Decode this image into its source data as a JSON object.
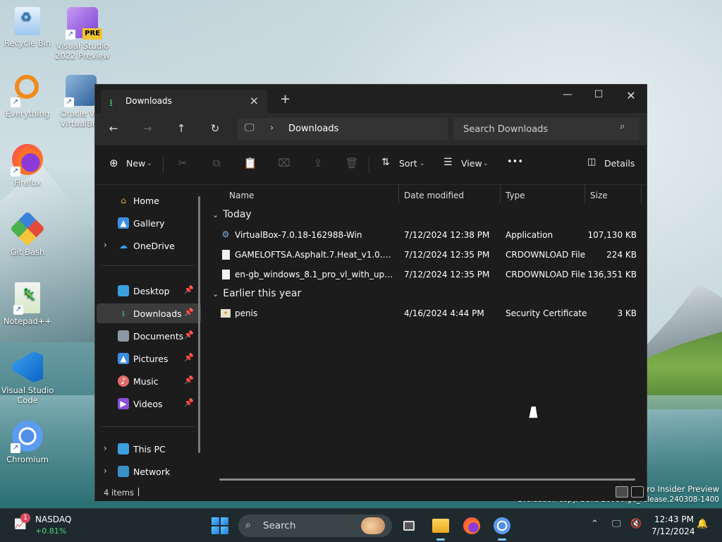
{
  "desktop": {
    "icons": [
      {
        "label": "Recycle Bin"
      },
      {
        "label": "Visual Studio 2022 Preview",
        "badge": "PRE"
      },
      {
        "label": "Everything"
      },
      {
        "label": "Oracle VM VirtualBox"
      },
      {
        "label": "Firefox"
      },
      {
        "label": "Git Bash"
      },
      {
        "label": "Notepad++"
      },
      {
        "label": "Visual Studio Code"
      },
      {
        "label": "Chromium"
      }
    ],
    "watermark_line1": "Pro Insider Preview",
    "watermark_line2": "Evaluation copy. Build 26080.ge_release.240308-1400"
  },
  "window": {
    "tab_title": "Downloads",
    "address_crumb": "Downloads",
    "search_placeholder": "Search Downloads",
    "toolbar": {
      "new_label": "New",
      "sort_label": "Sort",
      "view_label": "View",
      "more_label": "•••",
      "details_label": "Details"
    },
    "sidebar": {
      "items": [
        {
          "label": "Home"
        },
        {
          "label": "Gallery"
        },
        {
          "label": "OneDrive"
        },
        {
          "label": "Desktop"
        },
        {
          "label": "Downloads"
        },
        {
          "label": "Documents"
        },
        {
          "label": "Pictures"
        },
        {
          "label": "Music"
        },
        {
          "label": "Videos"
        },
        {
          "label": "This PC"
        },
        {
          "label": "Network"
        }
      ]
    },
    "columns": {
      "name": "Name",
      "date": "Date modified",
      "type": "Type",
      "size": "Size"
    },
    "groups": [
      {
        "label": "Today",
        "files": [
          {
            "name": "VirtualBox-7.0.18-162988-Win",
            "date": "7/12/2024 12:38 PM",
            "type": "Application",
            "size": "107,130 KB"
          },
          {
            "name": "GAMELOFTSA.Asphalt.7.Heat_v1.0.2.2.zip.crdownload",
            "date": "7/12/2024 12:35 PM",
            "type": "CRDOWNLOAD File",
            "size": "224 KB"
          },
          {
            "name": "en-gb_windows_8.1_pro_vl_with_update_x64.iso.crdownload",
            "date": "7/12/2024 12:35 PM",
            "type": "CRDOWNLOAD File",
            "size": "136,351 KB"
          }
        ]
      },
      {
        "label": "Earlier this year",
        "files": [
          {
            "name": "penis",
            "date": "4/16/2024 4:44 PM",
            "type": "Security Certificate",
            "size": "3 KB"
          }
        ]
      }
    ],
    "status_count": "4 items"
  },
  "taskbar": {
    "widget_badge": "1",
    "widget_title": "NASDAQ",
    "widget_value": "+0.81%",
    "search_label": "Search",
    "clock_time": "12:43 PM",
    "clock_date": "7/12/2024"
  },
  "colors": {
    "accent": "#3fc36b",
    "window_bg": "#1c1c1c",
    "selected": "#3b3b3b"
  }
}
